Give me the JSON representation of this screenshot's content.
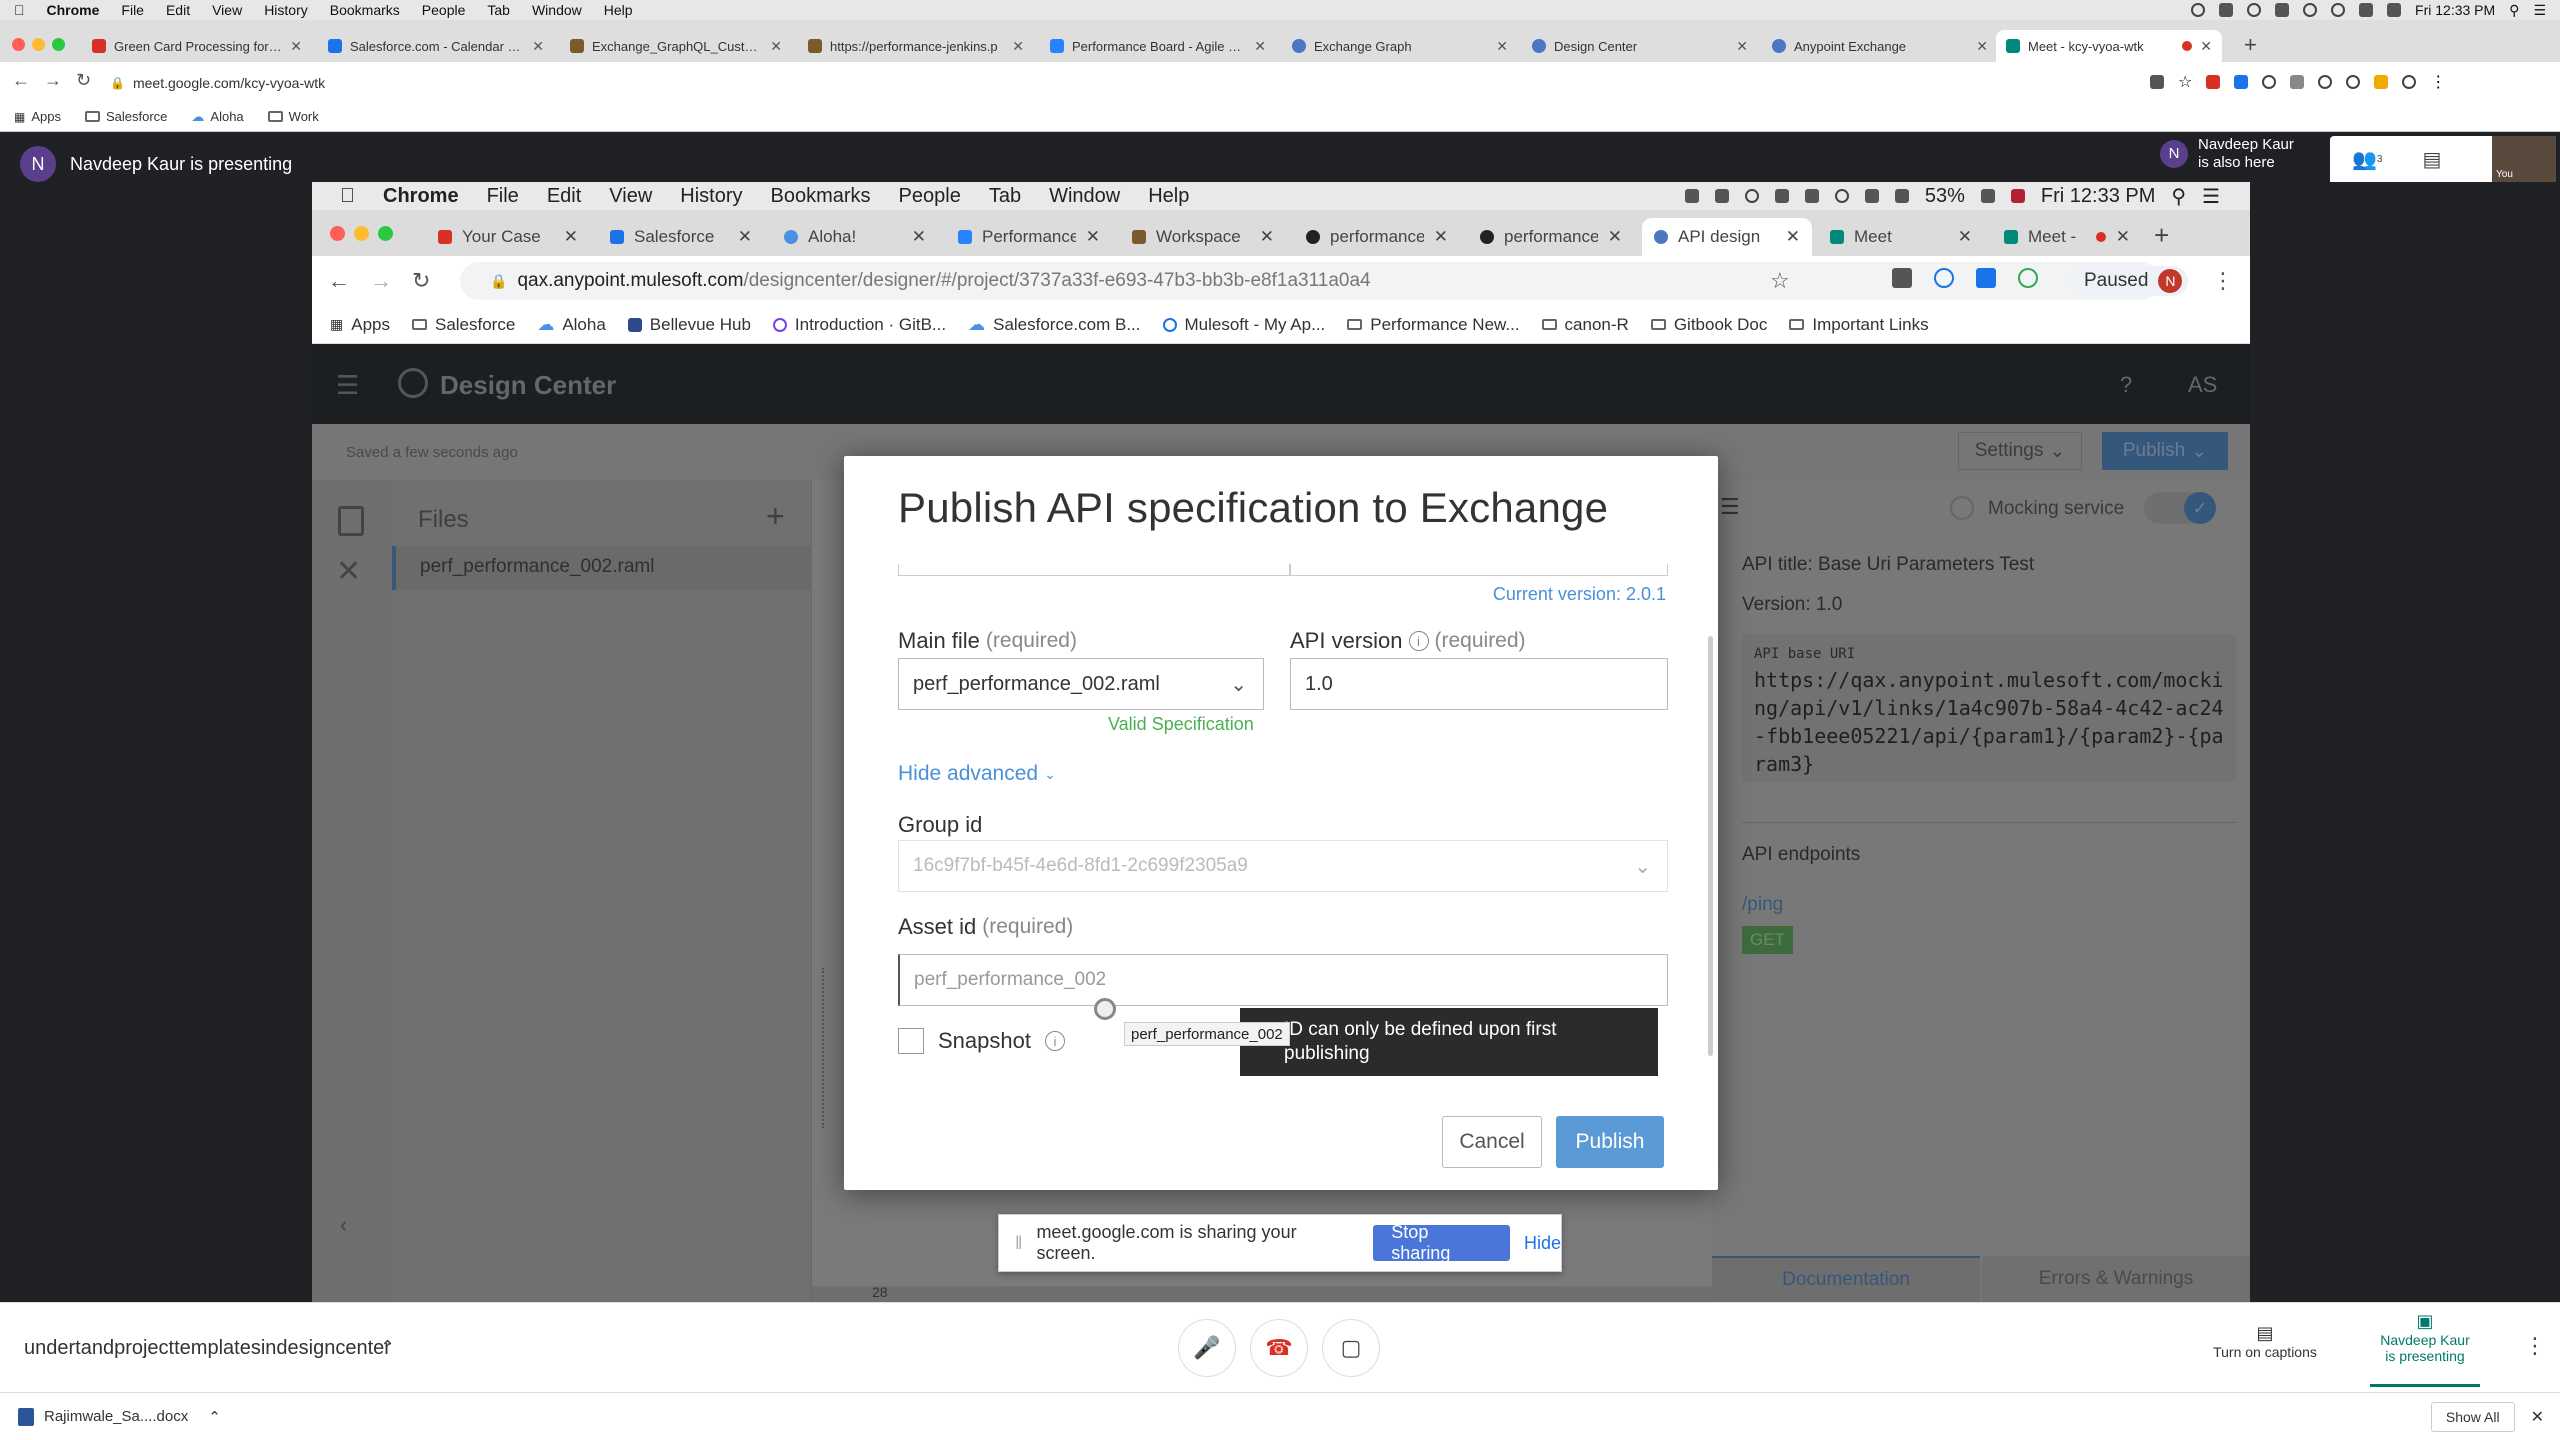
{
  "outer_menubar": {
    "app_name": "Chrome",
    "items": [
      "File",
      "Edit",
      "View",
      "History",
      "Bookmarks",
      "People",
      "Tab",
      "Window",
      "Help"
    ],
    "clock": "Fri 12:33 PM"
  },
  "outer_tabs": [
    {
      "title": "Green Card Processing for Sa",
      "favicon_color": "#d93025"
    },
    {
      "title": "Salesforce.com - Calendar - W",
      "favicon_color": "#1a73e8"
    },
    {
      "title": "Exchange_GraphQL_Custom_A",
      "favicon_color": "#7a5a2a"
    },
    {
      "title": "https://performance-jenkins.p",
      "favicon_color": "#7a5a2a"
    },
    {
      "title": "Performance Board - Agile Boa",
      "favicon_color": "#2684ff"
    },
    {
      "title": "Exchange Graph",
      "favicon_color": "#4a76c2"
    },
    {
      "title": "Design Center",
      "favicon_color": "#4a76c2"
    },
    {
      "title": "Anypoint Exchange",
      "favicon_color": "#4a76c2"
    },
    {
      "title": "Meet - kcy-vyoa-wtk",
      "favicon_color": "#00897b"
    }
  ],
  "outer_url": "meet.google.com/kcy-vyoa-wtk",
  "outer_bookmarks": [
    "Apps",
    "Salesforce",
    "Aloha",
    "Work"
  ],
  "meet": {
    "presenter_initial": "N",
    "presenter_text": "Navdeep Kaur is presenting",
    "also_here_line1": "Navdeep Kaur",
    "also_here_line2": "is also here",
    "participant_count": "3",
    "self_label": "You",
    "meeting_name": "undertandprojecttemplatesindesigncenter",
    "captions_label": "Turn on captions",
    "presenting_label_line1": "Navdeep Kaur",
    "presenting_label_line2": "is presenting"
  },
  "shared_screen": {
    "menubar": {
      "app_name": "Chrome",
      "items": [
        "File",
        "Edit",
        "View",
        "History",
        "Bookmarks",
        "People",
        "Tab",
        "Window",
        "Help"
      ],
      "battery": "53%",
      "clock": "Fri 12:33 PM"
    },
    "tabs": [
      {
        "title": "Your Case",
        "favicon_color": "#d93025"
      },
      {
        "title": "Salesforce",
        "favicon_color": "#1a73e8"
      },
      {
        "title": "Aloha!",
        "favicon_color": "#4a90e2"
      },
      {
        "title": "Performance",
        "favicon_color": "#2684ff"
      },
      {
        "title": "Workspace",
        "favicon_color": "#7a5a2a"
      },
      {
        "title": "performance",
        "favicon_color": "#222222"
      },
      {
        "title": "performance",
        "favicon_color": "#222222"
      },
      {
        "title": "API design",
        "favicon_color": "#4a76c2"
      },
      {
        "title": "Meet",
        "favicon_color": "#00897b"
      },
      {
        "title": "Meet -",
        "favicon_color": "#00897b"
      }
    ],
    "url_host": "qax.anypoint.mulesoft.com",
    "url_path": "/designcenter/designer/#/project/3737a33f-e693-47b3-bb3b-e8f1a311a0a4",
    "profile_status": "Paused",
    "profile_initial": "N",
    "bookmarks": [
      "Apps",
      "Salesforce",
      "Aloha",
      "Bellevue Hub",
      "Introduction · GitB...",
      "Salesforce.com B...",
      "Mulesoft - My Ap...",
      "Performance New...",
      "canon-R",
      "Gitbook Doc",
      "Important Links"
    ]
  },
  "design_center": {
    "title": "Design Center",
    "help": "?",
    "user_initials": "AS",
    "saved_status": "Saved a few seconds ago",
    "settings_label": "Settings",
    "publish_label": "Publish",
    "files_heading": "Files",
    "file_name": "perf_performance_002.raml",
    "mocking_label": "Mocking service",
    "api_title": "API title: Base Uri Parameters Test",
    "version": "Version: 1.0",
    "base_uri_label": "API base URI",
    "base_uri": "https://qax.anypoint.mulesoft.com/mocking/api/v1/links/1a4c907b-58a4-4c42-ac24-fbb1eee05221/api/{param1}/{param2}-{param3}",
    "endpoints_heading": "API endpoints",
    "endpoint_path": "/ping",
    "endpoint_method": "GET",
    "tab_documentation": "Documentation",
    "tab_errors": "Errors & Warnings",
    "line_number": "28"
  },
  "modal": {
    "title": "Publish API specification to Exchange",
    "current_version": "Current version: 2.0.1",
    "main_file_label": "Main file",
    "required_text": "(required)",
    "main_file_value": "perf_performance_002.raml",
    "valid_spec": "Valid Specification",
    "api_version_label": "API version",
    "api_version_value": "1.0",
    "hide_advanced": "Hide advanced",
    "group_id_label": "Group id",
    "group_id_value": "16c9f7bf-b45f-4e6d-8fd1-2c699f2305a9",
    "asset_id_label": "Asset id",
    "asset_id_value": "perf_performance_002",
    "snapshot_label": "Snapshot",
    "tooltip_text": "ID can only be defined upon first publishing",
    "hover_tip": "perf_performance_002",
    "cancel_label": "Cancel",
    "publish_label": "Publish"
  },
  "share_bar": {
    "message": "meet.google.com is sharing your screen.",
    "stop_label": "Stop sharing",
    "hide_label": "Hide"
  },
  "downloads": {
    "file_name": "Rajimwale_Sa....docx",
    "show_all": "Show All"
  },
  "colors": {
    "accent_blue": "#4a90d9",
    "valid_green": "#4caf50",
    "meet_dark": "#202124",
    "publish_button": "#5b9ad6",
    "hangup_red": "#d93025"
  }
}
